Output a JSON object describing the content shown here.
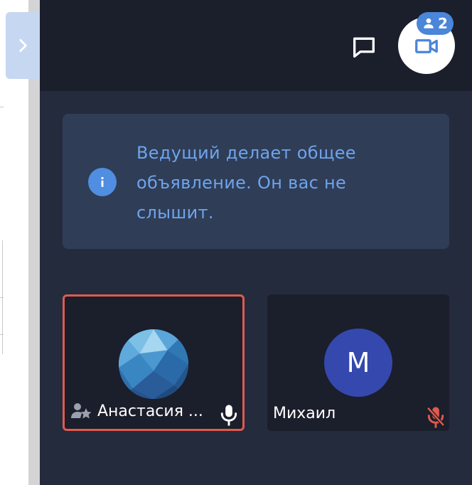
{
  "sidebar": {
    "toggle_icon": "chevron-right-icon"
  },
  "topbar": {
    "chat_icon": "chat-icon",
    "video_icon": "video-camera-icon",
    "participant_count": "2"
  },
  "notice": {
    "icon": "info-icon",
    "text": "Ведущий делает общее объявление. Он вас не слышит."
  },
  "participants": [
    {
      "name": "Анастасия ...",
      "role_icon": "moderator-icon",
      "mic": "mic-on",
      "avatar": "photo"
    },
    {
      "name": "Михаил",
      "initial": "М",
      "mic": "mic-muted",
      "avatar_color": "#3448ad"
    }
  ],
  "colors": {
    "panel": "#242b3d",
    "topbar": "#1b1e2b",
    "accent": "#4a86d9",
    "active_border": "#e05a4e",
    "muted": "#e05a4e"
  }
}
